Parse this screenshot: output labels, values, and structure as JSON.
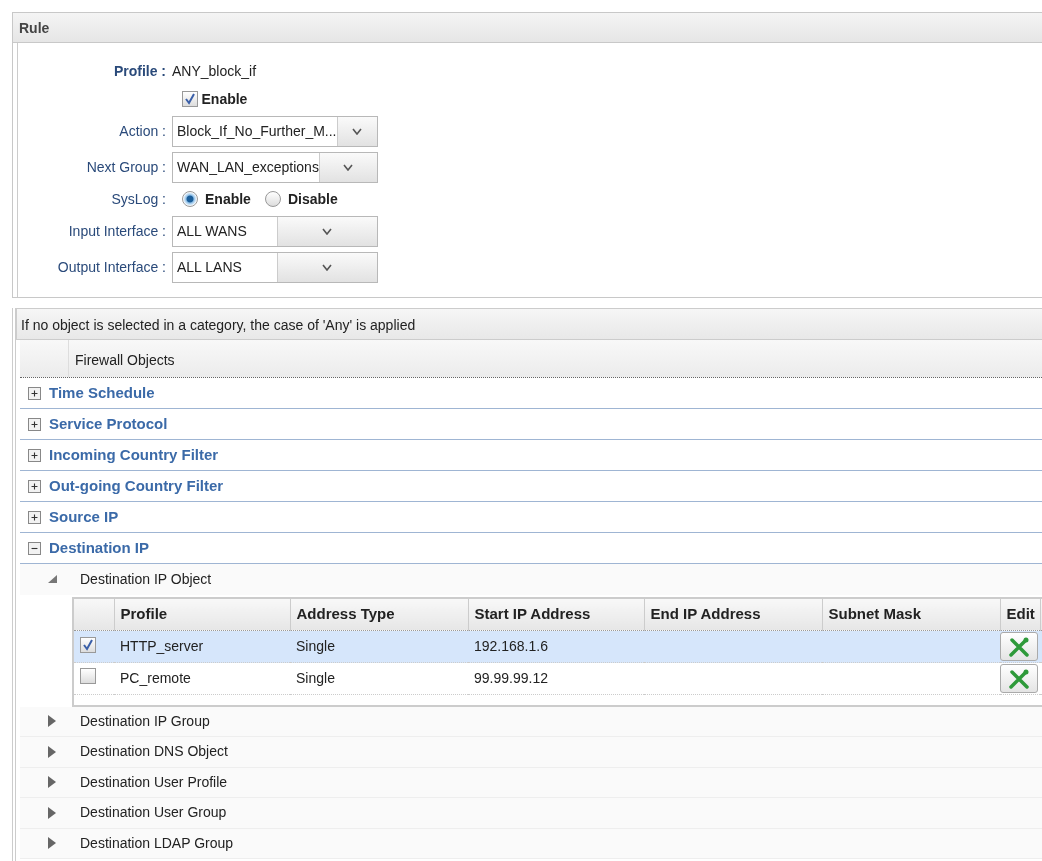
{
  "rule": {
    "title": "Rule",
    "fields": [
      {
        "kind": "text",
        "label": "Profile :",
        "value": "ANY_block_if"
      },
      {
        "kind": "checkbox",
        "label": "Enable",
        "checked": true
      },
      {
        "kind": "select",
        "label": "Action :",
        "value": "Block_If_No_Further_M..."
      },
      {
        "kind": "select",
        "label": "Next Group :",
        "value": "WAN_LAN_exceptions"
      },
      {
        "kind": "radio",
        "label": "SysLog :",
        "options": [
          {
            "label": "Enable",
            "selected": true
          },
          {
            "label": "Disable",
            "selected": false
          }
        ]
      },
      {
        "kind": "select",
        "label": "Input Interface :",
        "value": "ALL WANS"
      },
      {
        "kind": "select",
        "label": "Output Interface :",
        "value": "ALL LANS"
      }
    ]
  },
  "objects": {
    "notice": "If no object is selected in a category, the case of 'Any' is applied",
    "header": "Firewall Objects",
    "categories": [
      {
        "label": "Time Schedule",
        "expanded": false
      },
      {
        "label": "Service Protocol",
        "expanded": false
      },
      {
        "label": "Incoming Country Filter",
        "expanded": false
      },
      {
        "label": "Out-going Country Filter",
        "expanded": false
      },
      {
        "label": "Source IP",
        "expanded": false
      },
      {
        "label": "Destination IP",
        "expanded": true,
        "children": [
          {
            "label": "Destination IP Object",
            "expanded": true,
            "table": {
              "columns": [
                "Profile",
                "Address Type",
                "Start IP Address",
                "End IP Address",
                "Subnet Mask",
                "Edit"
              ],
              "rows": [
                {
                  "selected": true,
                  "checked": true,
                  "cells": [
                    "HTTP_server",
                    "Single",
                    "192.168.1.6",
                    "",
                    ""
                  ]
                },
                {
                  "selected": false,
                  "checked": false,
                  "cells": [
                    "PC_remote",
                    "Single",
                    "99.99.99.12",
                    "",
                    ""
                  ]
                }
              ]
            }
          },
          {
            "label": "Destination IP Group",
            "expanded": false
          },
          {
            "label": "Destination DNS Object",
            "expanded": false
          },
          {
            "label": "Destination User Profile",
            "expanded": false
          },
          {
            "label": "Destination User Group",
            "expanded": false
          },
          {
            "label": "Destination LDAP Group",
            "expanded": false
          }
        ]
      }
    ]
  }
}
